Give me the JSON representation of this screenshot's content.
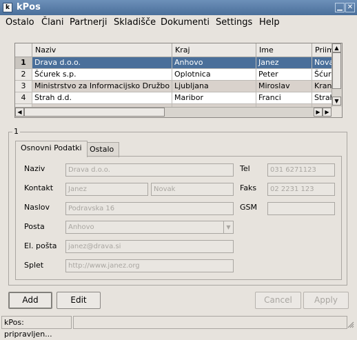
{
  "window": {
    "app_icon": "kpos-app-icon",
    "title": "kPos",
    "buttons": [
      "minimize-icon",
      "close-icon"
    ]
  },
  "menu": {
    "items": [
      {
        "label": "Ostalo"
      },
      {
        "label": "Člani"
      },
      {
        "label": "Partnerji"
      },
      {
        "label": "Skladišče"
      },
      {
        "label": "Dokumenti"
      },
      {
        "label": "Settings"
      },
      {
        "label": "Help"
      }
    ]
  },
  "table": {
    "columns": [
      "Naziv",
      "Kraj",
      "Ime",
      "Priim"
    ],
    "rows": [
      {
        "num": "1",
        "naziv": "Drava d.o.o.",
        "kraj": "Anhovo",
        "ime": "Janez",
        "priimek": "Nova"
      },
      {
        "num": "2",
        "naziv": "Šćurek s.p.",
        "kraj": "Oplotnica",
        "ime": "Peter",
        "priimek": "Šćure"
      },
      {
        "num": "3",
        "naziv": "Ministrstvo za Informacijsko Družbo",
        "kraj": "Ljubljana",
        "ime": "Miroslav",
        "priimek": "Kranj"
      },
      {
        "num": "4",
        "naziv": "Strah d.d.",
        "kraj": "Maribor",
        "ime": "Franci",
        "priimek": "Strah"
      }
    ],
    "selected_row": 1,
    "accent": "#4a6f9a"
  },
  "details": {
    "group_title": "1",
    "tabs": [
      {
        "label": "Osnovni Podatki",
        "active": true
      },
      {
        "label": "Ostalo",
        "active": false
      }
    ],
    "labels": {
      "naziv": "Naziv",
      "kontakt": "Kontakt",
      "naslov": "Naslov",
      "posta": "Posta",
      "email": "El. pošta",
      "splet": "Splet",
      "tel": "Tel",
      "faks": "Faks",
      "gsm": "GSM"
    },
    "values": {
      "naziv": "Drava d.o.o.",
      "kontakt_ime": "Janez",
      "kontakt_priimek": "Novak",
      "naslov": "Podravska 16",
      "posta": "Anhovo",
      "email": "janez@drava.si",
      "splet": "http://www.janez.org",
      "tel": "031 6271123",
      "faks": "02 2231 123",
      "gsm": ""
    }
  },
  "buttons": {
    "add": "Add",
    "edit": "Edit",
    "cancel": "Cancel",
    "apply": "Apply"
  },
  "status": {
    "text": "kPos: pripravljen..."
  }
}
